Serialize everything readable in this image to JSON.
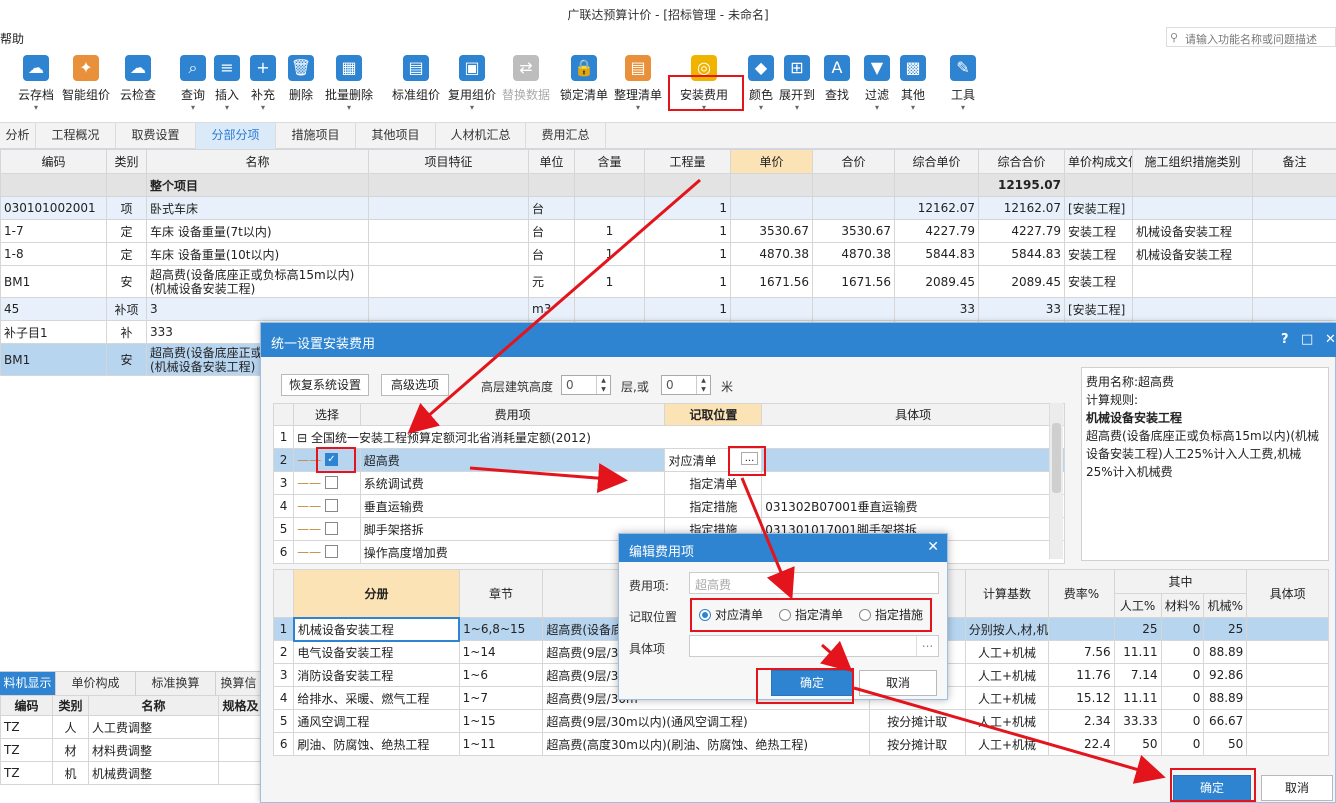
{
  "window": {
    "title": "广联达预算计价 - [招标管理 - 未命名]",
    "menu_help": "帮助",
    "search_placeholder": "请输入功能名称或问题描述"
  },
  "toolbar": [
    {
      "label": "云存档",
      "icon": "cloud-save-icon",
      "color": "#2e84d0",
      "dd": "▾"
    },
    {
      "label": "智能组价",
      "icon": "smart-price-icon",
      "color": "#e8903a",
      "dd": ""
    },
    {
      "label": "云检查",
      "icon": "cloud-check-icon",
      "color": "#2e84d0",
      "dd": ""
    },
    {
      "label": "查询",
      "icon": "query-icon",
      "color": "#2e84d0",
      "dd": "▾"
    },
    {
      "label": "插入",
      "icon": "insert-icon",
      "color": "#2e84d0",
      "dd": "▾"
    },
    {
      "label": "补充",
      "icon": "supplement-icon",
      "color": "#2e84d0",
      "dd": "▾"
    },
    {
      "label": "删除",
      "icon": "delete-icon",
      "color": "#2e84d0",
      "dd": ""
    },
    {
      "label": "批量删除",
      "icon": "batch-delete-icon",
      "color": "#2e84d0",
      "dd": "▾"
    },
    {
      "label": "标准组价",
      "icon": "standard-price-icon",
      "color": "#2e84d0",
      "dd": ""
    },
    {
      "label": "复用组价",
      "icon": "reuse-price-icon",
      "color": "#2e84d0",
      "dd": "▾"
    },
    {
      "label": "替换数据",
      "icon": "replace-data-icon",
      "color": "#bdbdbd",
      "dd": ""
    },
    {
      "label": "锁定清单",
      "icon": "lock-list-icon",
      "color": "#2e84d0",
      "dd": ""
    },
    {
      "label": "整理清单",
      "icon": "organize-list-icon",
      "color": "#e8903a",
      "dd": "▾"
    },
    {
      "label": "安装费用",
      "icon": "install-fee-icon",
      "color": "#f0b400",
      "dd": "▾"
    },
    {
      "label": "颜色",
      "icon": "color-icon",
      "color": "#2e84d0",
      "dd": "▾"
    },
    {
      "label": "展开到",
      "icon": "expand-icon",
      "color": "#2e84d0",
      "dd": "▾"
    },
    {
      "label": "查找",
      "icon": "find-icon",
      "color": "#2e84d0",
      "dd": ""
    },
    {
      "label": "过滤",
      "icon": "filter-icon",
      "color": "#2e84d0",
      "dd": "▾"
    },
    {
      "label": "其他",
      "icon": "other-icon",
      "color": "#2e84d0",
      "dd": "▾"
    },
    {
      "label": "工具",
      "icon": "tools-icon",
      "color": "#2e84d0",
      "dd": "▾"
    }
  ],
  "tabs": [
    "分析",
    "工程概况",
    "取费设置",
    "分部分项",
    "措施项目",
    "其他项目",
    "人材机汇总",
    "费用汇总"
  ],
  "active_tab": "分部分项",
  "main_headers": [
    "编码",
    "类别",
    "名称",
    "项目特征",
    "单位",
    "含量",
    "工程量",
    "单价",
    "合价",
    "综合单价",
    "综合合价",
    "单价构成文件",
    "施工组织措施类别",
    "备注"
  ],
  "main_rows": [
    {
      "code": "",
      "type": "",
      "name": "整个项目",
      "feature": "",
      "unit": "",
      "qty": "",
      "amount": "",
      "price": "",
      "total": "",
      "cprice": "",
      "ctotal": "12195.07",
      "file": "",
      "cat": ""
    },
    {
      "code": "030101002001",
      "type": "项",
      "name": "卧式车床",
      "feature": "",
      "unit": "台",
      "qty": "",
      "amount": "1",
      "price": "",
      "total": "",
      "cprice": "12162.07",
      "ctotal": "12162.07",
      "file": "[安装工程]",
      "cat": ""
    },
    {
      "code": "1-7",
      "type": "定",
      "name": "车床 设备重量(7t以内)",
      "feature": "",
      "unit": "台",
      "qty": "1",
      "amount": "1",
      "price": "3530.67",
      "total": "3530.67",
      "cprice": "4227.79",
      "ctotal": "4227.79",
      "file": "安装工程",
      "cat": "机械设备安装工程"
    },
    {
      "code": "1-8",
      "type": "定",
      "name": "车床 设备重量(10t以内)",
      "feature": "",
      "unit": "台",
      "qty": "1",
      "amount": "1",
      "price": "4870.38",
      "total": "4870.38",
      "cprice": "5844.83",
      "ctotal": "5844.83",
      "file": "安装工程",
      "cat": "机械设备安装工程"
    },
    {
      "code": "BM1",
      "type": "安",
      "name": "超高费(设备底座正或负标高15m以内)(机械设备安装工程)",
      "feature": "",
      "unit": "元",
      "qty": "1",
      "amount": "1",
      "price": "1671.56",
      "total": "1671.56",
      "cprice": "2089.45",
      "ctotal": "2089.45",
      "file": "安装工程",
      "cat": ""
    },
    {
      "code": "45",
      "type": "补项",
      "name": "3",
      "feature": "",
      "unit": "m3",
      "qty": "",
      "amount": "1",
      "price": "",
      "total": "",
      "cprice": "33",
      "ctotal": "33",
      "file": "[安装工程]",
      "cat": ""
    },
    {
      "code": "补子目1",
      "type": "补",
      "name": "333",
      "feature": "",
      "unit": "",
      "qty": "",
      "amount": "",
      "price": "",
      "total": "",
      "cprice": "",
      "ctotal": "",
      "file": "",
      "cat": ""
    },
    {
      "code": "BM1",
      "type": "安",
      "name": "超高费(设备底座正或负标高15m以内)(机械设备安装工程)",
      "feature": "",
      "unit": "",
      "qty": "",
      "amount": "",
      "price": "",
      "total": "",
      "cprice": "",
      "ctotal": "",
      "file": "",
      "cat": ""
    }
  ],
  "bottom_left": {
    "tabs": [
      "料机显示",
      "单价构成",
      "标准换算",
      "换算信息"
    ],
    "headers": [
      "编码",
      "类别",
      "名称",
      "规格及"
    ],
    "rows": [
      [
        "TZ",
        "人",
        "人工费调整"
      ],
      [
        "TZ",
        "材",
        "材料费调整"
      ],
      [
        "TZ",
        "机",
        "机械费调整"
      ]
    ]
  },
  "dialog": {
    "title": "统一设置安装费用",
    "btn_restore": "恢复系统设置",
    "btn_advanced": "高级选项",
    "height_label": "高层建筑高度",
    "height_value": "0",
    "unit_floor": "层,或",
    "height_value2": "0",
    "unit_m": "米",
    "up_headers": [
      "选择",
      "费用项",
      "记取位置",
      "具体项"
    ],
    "up_rows": [
      {
        "no": "1",
        "check": "",
        "name": "全国统一安装工程预算定额河北省消耗量定额(2012)",
        "pos": "",
        "detail": ""
      },
      {
        "no": "2",
        "check": "on",
        "name": "超高费",
        "pos": "对应清单",
        "detail": "..."
      },
      {
        "no": "3",
        "check": "off",
        "name": "系统调试费",
        "pos": "指定清单",
        "detail": ""
      },
      {
        "no": "4",
        "check": "off",
        "name": "垂直运输费",
        "pos": "指定措施",
        "detail": "031302B07001垂直运输费"
      },
      {
        "no": "5",
        "check": "off",
        "name": "脚手架搭拆",
        "pos": "指定措施",
        "detail": "031301017001脚手架搭拆"
      },
      {
        "no": "6",
        "check": "off",
        "name": "操作高度增加费",
        "pos": "",
        "detail": ""
      }
    ],
    "info": {
      "name_line": "费用名称:超高费",
      "rule_label": "计算规则:",
      "rule_title": "机械设备安装工程",
      "rule_text": "超高费(设备底座正或负标高15m以内)(机械设备安装工程)人工25%计入人工费,机械25%计入机械费"
    },
    "low_headers": {
      "book": "分册",
      "chapter": "章节",
      "name": "",
      "method": "式",
      "base": "计算基数",
      "rate": "费率%",
      "among": "其中",
      "labor": "人工%",
      "mat": "材料%",
      "mach": "机械%",
      "detail": "具体项"
    },
    "low_rows": [
      {
        "no": "1",
        "book": "机械设备安装工程",
        "chapter": "1~6,8~15",
        "name": "超高费(设备底座",
        "method": "",
        "base": "分别按人,材,机取费",
        "rate": "",
        "labor": "25",
        "mat": "0",
        "mach": "25"
      },
      {
        "no": "2",
        "book": "电气设备安装工程",
        "chapter": "1~14",
        "name": "超高费(9层/30m",
        "method": "",
        "base": "人工+机械",
        "rate": "7.56",
        "labor": "11.11",
        "mat": "0",
        "mach": "88.89"
      },
      {
        "no": "3",
        "book": "消防设备安装工程",
        "chapter": "1~6",
        "name": "超高费(9层/30m",
        "method": "",
        "base": "人工+机械",
        "rate": "11.76",
        "labor": "7.14",
        "mat": "0",
        "mach": "92.86"
      },
      {
        "no": "4",
        "book": "给排水、采暖、燃气工程",
        "chapter": "1~7",
        "name": "超高费(9层/30m",
        "method": "",
        "base": "人工+机械",
        "rate": "15.12",
        "labor": "11.11",
        "mat": "0",
        "mach": "88.89"
      },
      {
        "no": "5",
        "book": "通风空调工程",
        "chapter": "1~15",
        "name": "超高费(9层/30m以内)(通风空调工程)",
        "method": "按分摊计取",
        "base": "人工+机械",
        "rate": "2.34",
        "labor": "33.33",
        "mat": "0",
        "mach": "66.67"
      },
      {
        "no": "6",
        "book": "刷油、防腐蚀、绝热工程",
        "chapter": "1~11",
        "name": "超高费(高度30m以内)(刷油、防腐蚀、绝热工程)",
        "method": "按分摊计取",
        "base": "人工+机械",
        "rate": "22.4",
        "labor": "50",
        "mat": "0",
        "mach": "50"
      }
    ],
    "ok": "确定",
    "cancel": "取消"
  },
  "edit_dialog": {
    "title": "编辑费用项",
    "fee_label": "费用项:",
    "fee_value": "超高费",
    "pos_label": "记取位置",
    "options": [
      "对应清单",
      "指定清单",
      "指定措施"
    ],
    "selected": "对应清单",
    "detail_label": "具体项",
    "detail_btn": "...",
    "ok": "确定",
    "cancel": "取消"
  }
}
